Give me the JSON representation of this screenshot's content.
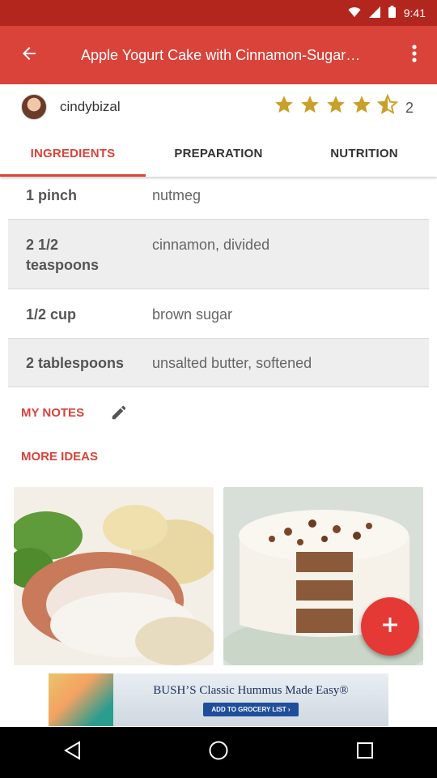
{
  "status_bar": {
    "time": "9:41"
  },
  "app_bar": {
    "title": "Apple Yogurt Cake with Cinnamon-Sugar…"
  },
  "author": {
    "name": "cindybizal"
  },
  "rating": {
    "stars": 4.5,
    "max_stars": 5,
    "count": "2"
  },
  "tabs": [
    {
      "label": "INGREDIENTS",
      "active": true
    },
    {
      "label": "PREPARATION",
      "active": false
    },
    {
      "label": "NUTRITION",
      "active": false
    }
  ],
  "ingredients": [
    {
      "qty": "1 pinch",
      "name": "nutmeg"
    },
    {
      "qty": "2 1/2 teaspoons",
      "name": "cinnamon, divided"
    },
    {
      "qty": "1/2 cup",
      "name": "brown sugar"
    },
    {
      "qty": "2 tablespoons",
      "name": "unsalted butter, softened"
    }
  ],
  "notes": {
    "label": "MY NOTES"
  },
  "more_ideas": {
    "label": "MORE IDEAS"
  },
  "ad": {
    "headline": "BUSH’S Classic Hummus Made Easy®",
    "cta": "ADD TO GROCERY LIST ›"
  },
  "colors": {
    "accent": "#d9433a",
    "status_bar": "#b3261e",
    "fab": "#e53935",
    "star": "#c8a02a"
  },
  "icons": [
    "back-arrow-icon",
    "more-vert-icon",
    "star-icon",
    "star-half-icon",
    "edit-pencil-icon",
    "plus-icon",
    "nav-back-icon",
    "nav-home-icon",
    "nav-recents-icon"
  ]
}
